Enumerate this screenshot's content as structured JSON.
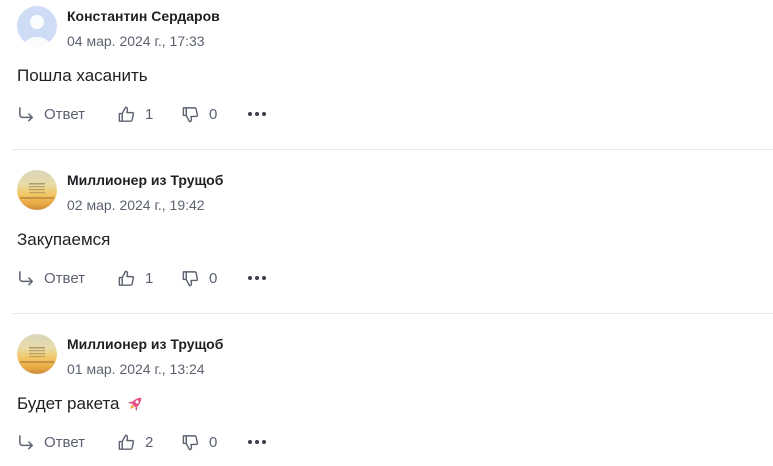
{
  "comments": [
    {
      "author": "Константин Сердаров",
      "date": "04 мар. 2024 г., 17:33",
      "text": "Пошла хасанить",
      "reply_label": "Ответ",
      "likes": "1",
      "dislikes": "0"
    },
    {
      "author": "Миллионер из Трущоб",
      "date": "02 мар. 2024 г., 19:42",
      "text": "Закупаемся",
      "reply_label": "Ответ",
      "likes": "1",
      "dislikes": "0"
    },
    {
      "author": "Миллионер из Трущоб",
      "date": "01 мар. 2024 г., 13:24",
      "text": "Будет ракета",
      "text_emoji": "rocket-emoji",
      "reply_label": "Ответ",
      "likes": "2",
      "dislikes": "0"
    }
  ],
  "icons": {
    "reply": "reply-arrow-icon",
    "like": "thumbs-up-icon",
    "dislike": "thumbs-down-icon",
    "more": "more-dots-icon"
  },
  "colors": {
    "text": "#1f1f24",
    "muted": "#5c6270",
    "divider": "#e4e6ea",
    "rocket": "#e8508a"
  }
}
